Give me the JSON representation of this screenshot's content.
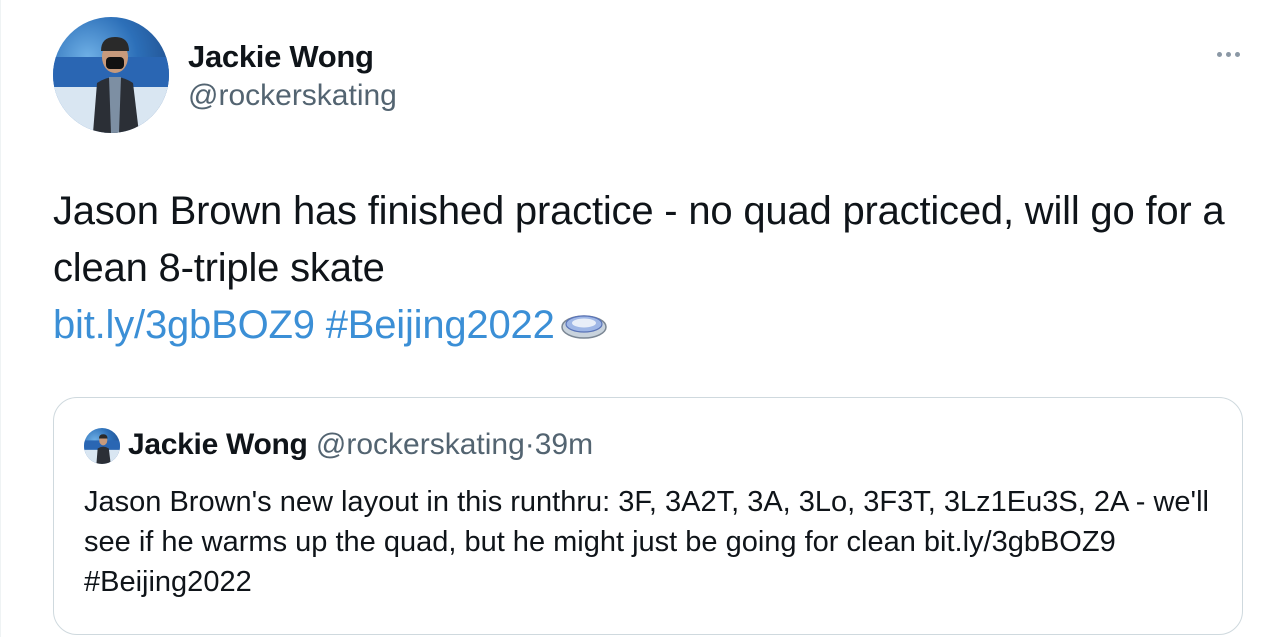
{
  "author": {
    "display_name": "Jackie Wong",
    "handle": "@rockerskating"
  },
  "more_icon": "more-horizontal-icon",
  "tweet": {
    "text": "Jason Brown has finished practice - no quad practiced, will go for a clean 8-triple skate",
    "link": "bit.ly/3gbBOZ9",
    "hashtag": "#Beijing2022",
    "emoji_icon": "ice-rink-icon"
  },
  "quoted": {
    "display_name": "Jackie Wong",
    "handle": "@rockerskating",
    "separator": "·",
    "time": "39m",
    "text": "Jason Brown's new layout in this runthru: 3F, 3A2T, 3A, 3Lo, 3F3T, 3Lz1Eu3S, 2A - we'll see if he warms up the quad, but he might just be going for clean bit.ly/3gbBOZ9 #Beijing2022"
  },
  "colors": {
    "link": "#3b8fd6",
    "secondary_text": "#536471",
    "border": "#cfd9de"
  }
}
